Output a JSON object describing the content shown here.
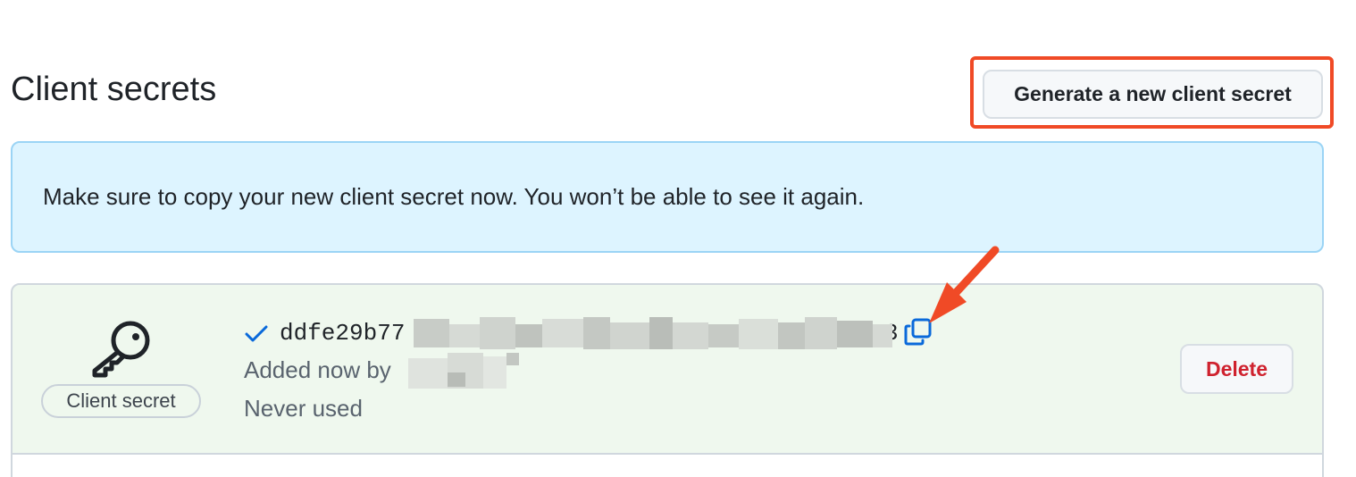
{
  "section": {
    "title": "Client secrets",
    "generate_button_label": "Generate a new client secret"
  },
  "flash": {
    "message": "Make sure to copy your new client secret now. You won’t be able to see it again."
  },
  "secret": {
    "type_label": "Client secret",
    "value_prefix": "ddfe29b77",
    "value_suffix": "3",
    "added_by_prefix": "Added now by",
    "usage": "Never used",
    "delete_label": "Delete"
  },
  "colors": {
    "highlight": "#f04a26",
    "flash_bg": "#ddf4ff",
    "secret_bg": "#eff8ee",
    "danger": "#cf222e",
    "accent": "#0969da"
  },
  "icons": {
    "secret_type": "key-icon",
    "status": "check-icon",
    "copy": "copy-icon",
    "annotation": "arrow-icon"
  }
}
